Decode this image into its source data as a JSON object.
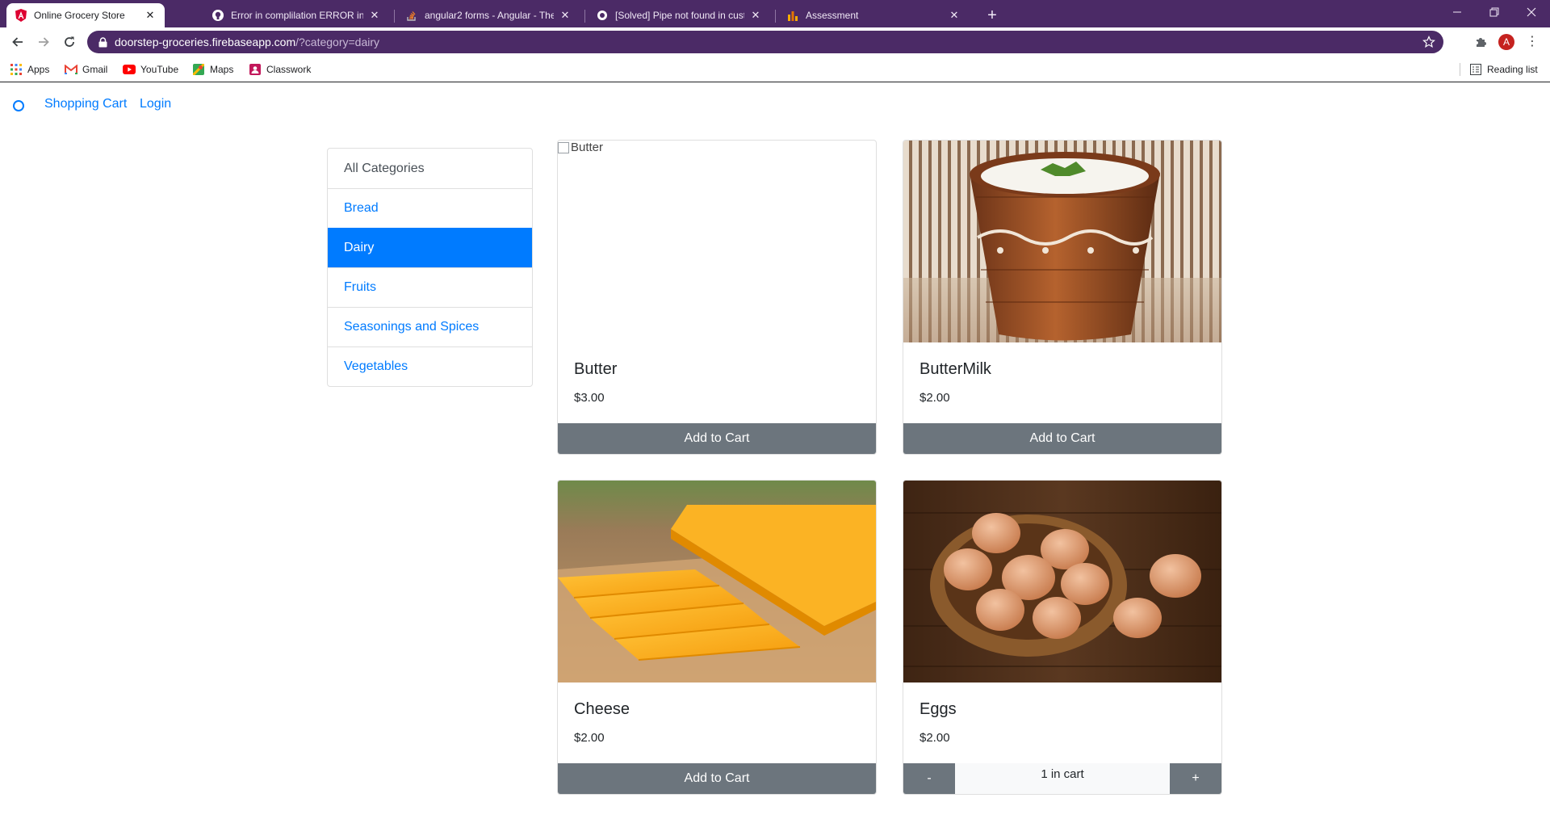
{
  "browser": {
    "tabs": [
      {
        "title": "Online Grocery Store",
        "icon": "angular-icon",
        "active": true
      },
      {
        "title": "Error in complilation ERROR in nc",
        "icon": "github-icon",
        "active": false
      },
      {
        "title": "angular2 forms - Angular - There",
        "icon": "stackoverflow-icon",
        "active": false
      },
      {
        "title": "[Solved] Pipe not found in custor",
        "icon": "solved-icon",
        "active": false
      },
      {
        "title": "Assessment",
        "icon": "chart-icon",
        "active": false
      }
    ],
    "url_host": "doorstep-groceries.firebaseapp.com",
    "url_path": "/?category=dairy",
    "profile_initial": "A",
    "bookmarks": [
      {
        "label": "Apps",
        "icon": "apps-grid-icon"
      },
      {
        "label": "Gmail",
        "icon": "gmail-icon"
      },
      {
        "label": "YouTube",
        "icon": "youtube-icon"
      },
      {
        "label": "Maps",
        "icon": "maps-icon"
      },
      {
        "label": "Classwork",
        "icon": "classroom-icon"
      }
    ],
    "reading_list": "Reading list",
    "theme_color": "#4b2a66"
  },
  "nav": {
    "cart_label": "Shopping Cart",
    "login_label": "Login"
  },
  "categories": [
    {
      "label": "All Categories",
      "active": false
    },
    {
      "label": "Bread",
      "active": false
    },
    {
      "label": "Dairy",
      "active": true
    },
    {
      "label": "Fruits",
      "active": false
    },
    {
      "label": "Seasonings and Spices",
      "active": false
    },
    {
      "label": "Vegetables",
      "active": false
    }
  ],
  "products": [
    {
      "title": "Butter",
      "price": "$3.00",
      "image_alt": "Butter",
      "action": "Add to Cart"
    },
    {
      "title": "ButterMilk",
      "price": "$2.00",
      "action": "Add to Cart"
    },
    {
      "title": "Cheese",
      "price": "$2.00",
      "action": "Add to Cart"
    },
    {
      "title": "Eggs",
      "price": "$2.00",
      "qty_minus": "-",
      "qty_text": "1 in cart",
      "qty_plus": "+"
    }
  ],
  "colors": {
    "primary": "#007bff",
    "secondary": "#6c757d"
  }
}
